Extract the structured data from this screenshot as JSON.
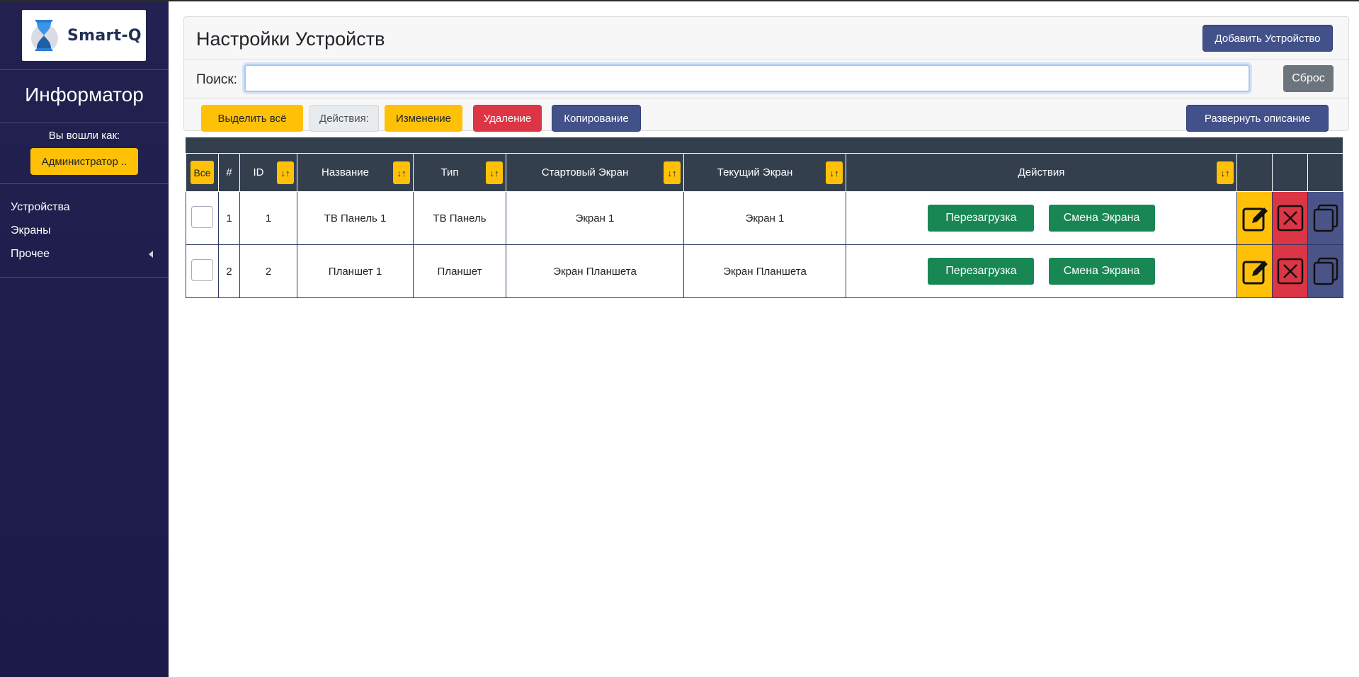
{
  "sidebar": {
    "logo_text": "Smart-Q",
    "title": "Информатор",
    "logged_in_label": "Вы вошли как:",
    "user_button": "Администратор ..",
    "nav": [
      {
        "label": "Устройства"
      },
      {
        "label": "Экраны"
      },
      {
        "label": "Прочее",
        "icon": "caret-left-icon"
      }
    ]
  },
  "header": {
    "title": "Настройки Устройств",
    "add_button": "Добавить Устройство"
  },
  "search": {
    "label": "Поиск:",
    "value": "",
    "placeholder": "",
    "reset_button": "Сброс"
  },
  "toolbar": {
    "select_all": "Выделить всё",
    "actions_label": "Действия:",
    "edit": "Изменение",
    "delete": "Удаление",
    "copy": "Копирование",
    "expand": "Развернуть описание"
  },
  "table": {
    "all_button": "Все",
    "sort_symbol": "↓↑",
    "columns": {
      "num": "#",
      "id": "ID",
      "name": "Название",
      "type": "Тип",
      "start_screen": "Стартовый Экран",
      "current_screen": "Текущий Экран",
      "actions": "Действия"
    },
    "rows": [
      {
        "num": "1",
        "id": "1",
        "name": "ТВ Панель 1",
        "type": "ТВ Панель",
        "start_screen": "Экран 1",
        "current_screen": "Экран 1",
        "reboot": "Перезагрузка",
        "change_screen": "Смена Экрана"
      },
      {
        "num": "2",
        "id": "2",
        "name": "Планшет 1",
        "type": "Планшет",
        "start_screen": "Экран Планшета",
        "current_screen": "Экран Планшета",
        "reboot": "Перезагрузка",
        "change_screen": "Смена Экрана"
      }
    ]
  },
  "colors": {
    "sidebar_bg": "#1e1d4b",
    "primary": "#42518a",
    "warning": "#ffc107",
    "danger": "#dc3545",
    "success": "#198754",
    "table_header": "#343f4e"
  }
}
